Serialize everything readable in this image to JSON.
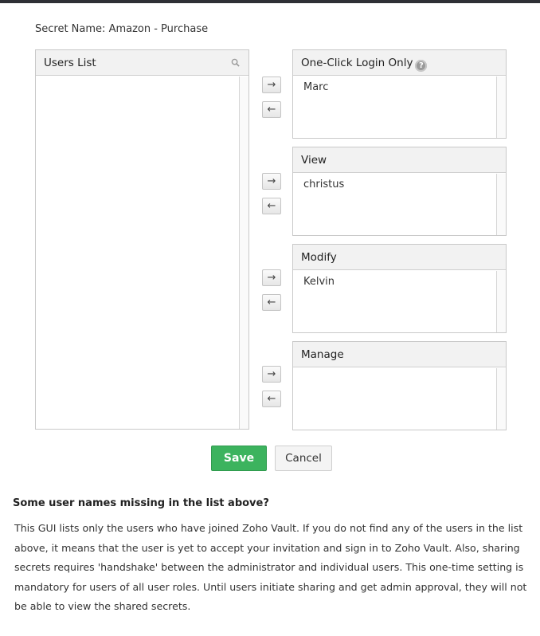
{
  "secret": {
    "label": "Secret Name:",
    "value": "Amazon - Purchase"
  },
  "users_list": {
    "title": "Users List",
    "icon": "search-icon",
    "items": []
  },
  "arrows": {
    "right": "→",
    "left": "←"
  },
  "panels": [
    {
      "title": "One-Click Login Only",
      "help_icon": "?",
      "items": [
        "Marc"
      ]
    },
    {
      "title": "View",
      "items": [
        "christus"
      ]
    },
    {
      "title": "Modify",
      "items": [
        "Kelvin"
      ]
    },
    {
      "title": "Manage",
      "items": []
    }
  ],
  "buttons": {
    "save": "Save",
    "cancel": "Cancel"
  },
  "help": {
    "title": "Some user names missing in the list above?",
    "text": "This GUI lists only the users who have joined Zoho Vault. If you do not find any of the users in the list above, it means that the user is yet to accept your invitation and sign in to Zoho Vault. Also, sharing secrets requires 'handshake' between the administrator and individual users. This one-time setting is mandatory for users of all user roles. Until users initiate sharing and get admin approval, they will not be able to view the shared secrets."
  },
  "colors": {
    "save_button": "#3cb35e",
    "header_bg": "#f2f2f2",
    "border": "#c9c9c9"
  }
}
